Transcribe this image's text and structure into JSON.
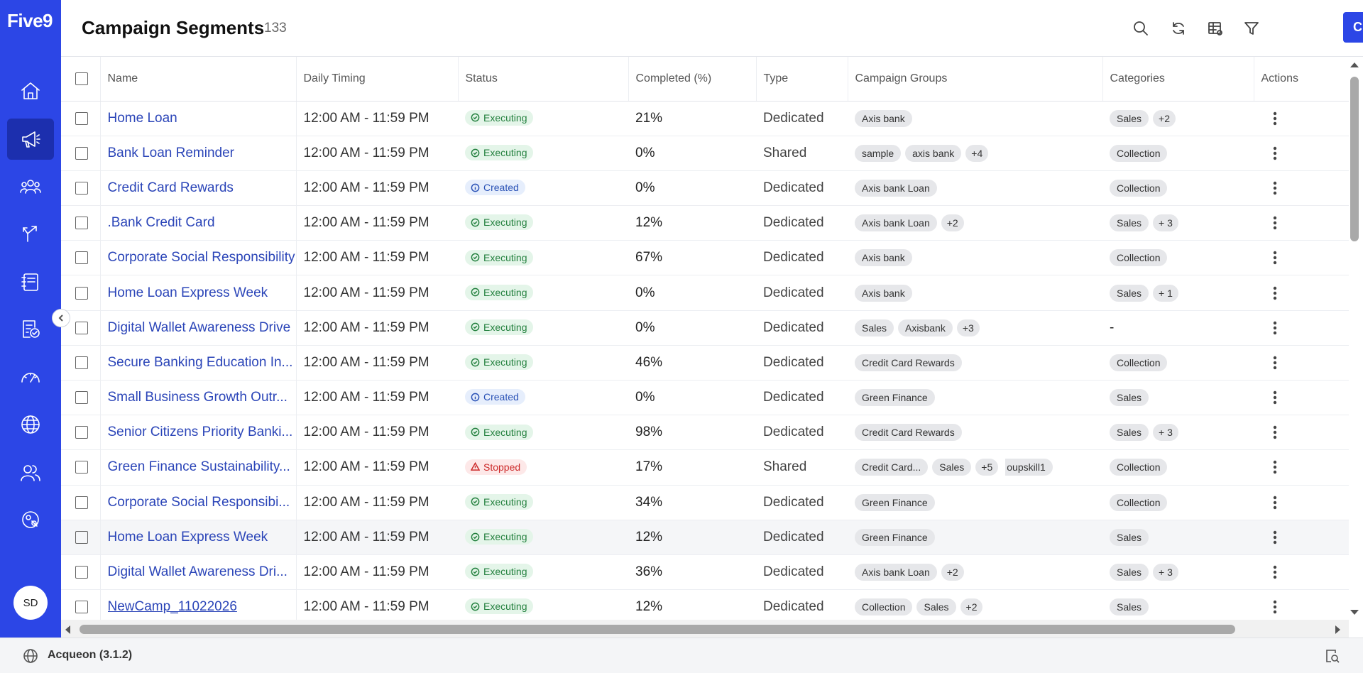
{
  "app": {
    "logo": "Five9",
    "user_initials": "SD",
    "version_label": "Acqueon (3.1.2)"
  },
  "header": {
    "title": "Campaign Segments",
    "count": "133",
    "create_label": "Create"
  },
  "columns": {
    "name": "Name",
    "daily_timing": "Daily Timing",
    "status": "Status",
    "completed": "Completed (%)",
    "type": "Type",
    "campaign_groups": "Campaign Groups",
    "categories": "Categories",
    "actions": "Actions"
  },
  "rows": [
    {
      "name": "Home Loan",
      "timing": "12:00 AM - 11:59 PM",
      "status": "Executing",
      "completed": "21%",
      "type": "Dedicated",
      "groups": [
        "Axis bank"
      ],
      "groups_more": "",
      "categories": [
        "Sales"
      ],
      "categories_more": "+2"
    },
    {
      "name": "Bank Loan Reminder",
      "timing": "12:00 AM - 11:59 PM",
      "status": "Executing",
      "completed": "0%",
      "type": "Shared",
      "groups": [
        "sample",
        "axis bank"
      ],
      "groups_more": "+4",
      "categories": [
        "Collection"
      ],
      "categories_more": ""
    },
    {
      "name": "Credit Card Rewards",
      "timing": "12:00 AM - 11:59 PM",
      "status": "Created",
      "completed": "0%",
      "type": "Dedicated",
      "groups": [
        "Axis bank Loan"
      ],
      "groups_more": "",
      "categories": [
        "Collection"
      ],
      "categories_more": ""
    },
    {
      "name": ".Bank Credit Card",
      "timing": "12:00 AM - 11:59 PM",
      "status": "Executing",
      "completed": "12%",
      "type": "Dedicated",
      "groups": [
        "Axis bank Loan"
      ],
      "groups_more": "+2",
      "categories": [
        "Sales"
      ],
      "categories_more": "+ 3"
    },
    {
      "name": "Corporate Social Responsibility",
      "timing": "12:00 AM - 11:59 PM",
      "status": "Executing",
      "completed": "67%",
      "type": "Dedicated",
      "groups": [
        "Axis bank"
      ],
      "groups_more": "",
      "categories": [
        "Collection"
      ],
      "categories_more": ""
    },
    {
      "name": "Home Loan Express Week",
      "timing": "12:00 AM - 11:59 PM",
      "status": "Executing",
      "completed": "0%",
      "type": "Dedicated",
      "groups": [
        "Axis bank"
      ],
      "groups_more": "",
      "categories": [
        "Sales"
      ],
      "categories_more": "+ 1"
    },
    {
      "name": "Digital Wallet Awareness Drive",
      "timing": "12:00 AM - 11:59 PM",
      "status": "Executing",
      "completed": "0%",
      "type": "Dedicated",
      "groups": [
        "Sales",
        "Axisbank"
      ],
      "groups_more": "+3",
      "categories": [],
      "categories_more": "",
      "categories_empty": "-"
    },
    {
      "name": "Secure Banking Education In...",
      "timing": "12:00 AM - 11:59 PM",
      "status": "Executing",
      "completed": "46%",
      "type": "Dedicated",
      "groups": [
        "Credit Card Rewards"
      ],
      "groups_more": "",
      "categories": [
        "Collection"
      ],
      "categories_more": ""
    },
    {
      "name": "Small Business Growth Outr...",
      "timing": "12:00 AM - 11:59 PM",
      "status": "Created",
      "completed": "0%",
      "type": "Dedicated",
      "groups": [
        "Green Finance"
      ],
      "groups_more": "",
      "categories": [
        "Sales"
      ],
      "categories_more": ""
    },
    {
      "name": "Senior Citizens Priority Banki...",
      "timing": "12:00 AM - 11:59 PM",
      "status": "Executing",
      "completed": "98%",
      "type": "Dedicated",
      "groups": [
        "Credit Card Rewards"
      ],
      "groups_more": "",
      "categories": [
        "Sales"
      ],
      "categories_more": "+ 3"
    },
    {
      "name": "Green Finance Sustainability...",
      "timing": "12:00 AM - 11:59 PM",
      "status": "Stopped",
      "completed": "17%",
      "type": "Shared",
      "groups": [
        "Credit Card...",
        "Sales"
      ],
      "groups_more": "+5",
      "groups_tail": "oupskill1",
      "categories": [
        "Collection"
      ],
      "categories_more": ""
    },
    {
      "name": "Corporate Social Responsibi...",
      "timing": "12:00 AM - 11:59 PM",
      "status": "Executing",
      "completed": "34%",
      "type": "Dedicated",
      "groups": [
        "Green Finance"
      ],
      "groups_more": "",
      "categories": [
        "Collection"
      ],
      "categories_more": ""
    },
    {
      "name": "Home Loan Express Week",
      "timing": "12:00 AM - 11:59 PM",
      "status": "Executing",
      "completed": "12%",
      "type": "Dedicated",
      "groups": [
        "Green Finance"
      ],
      "groups_more": "",
      "categories": [
        "Sales"
      ],
      "categories_more": ""
    },
    {
      "name": "Digital Wallet Awareness Dri...",
      "timing": "12:00 AM - 11:59 PM",
      "status": "Executing",
      "completed": "36%",
      "type": "Dedicated",
      "groups": [
        "Axis bank Loan"
      ],
      "groups_more": "+2",
      "categories": [
        "Sales"
      ],
      "categories_more": "+ 3"
    },
    {
      "name": "NewCamp_11022026",
      "timing": "12:00 AM - 11:59 PM",
      "status": "Executing",
      "completed": "12%",
      "type": "Dedicated",
      "groups": [
        "Collection",
        "Sales"
      ],
      "groups_more": "+2",
      "categories": [
        "Sales"
      ],
      "categories_more": ""
    }
  ],
  "colors": {
    "sidebar": "#2c46e6",
    "accent": "#2c46e6",
    "link": "#2b45b8",
    "executing": "#23803e",
    "created": "#2a52b6",
    "stopped": "#cc2a2a"
  },
  "sidebar_icons": [
    "home-icon",
    "megaphone-icon",
    "people-group-icon",
    "routing-icon",
    "notebook-icon",
    "report-check-icon",
    "dashboard-gauge-icon",
    "globe-icon",
    "users-icon",
    "settings-gear-icon"
  ]
}
